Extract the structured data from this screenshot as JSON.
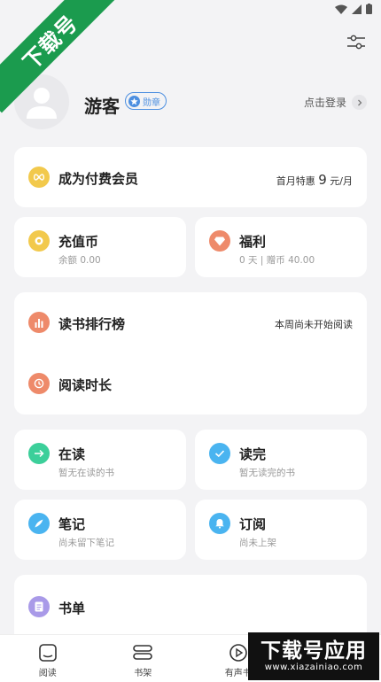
{
  "watermarks": {
    "top_left": "下载号",
    "bottom_right_big": "下载号应用",
    "bottom_right_small": "www.xiazainiao.com"
  },
  "profile": {
    "username": "游客",
    "badge_label": "勋章",
    "login_label": "点击登录"
  },
  "membership": {
    "title": "成为付费会员",
    "price_prefix": "首月特惠",
    "price_value": "9",
    "price_suffix": "元/月"
  },
  "recharge": {
    "title": "充值币",
    "sub": "余额 0.00"
  },
  "welfare": {
    "title": "福利",
    "sub": "0 天 | 赠币 40.00"
  },
  "ranking": {
    "title": "读书排行榜",
    "status": "本周尚未开始阅读"
  },
  "reading_time": {
    "title": "阅读时长"
  },
  "reading": {
    "title": "在读",
    "sub": "暂无在读的书"
  },
  "finished": {
    "title": "读完",
    "sub": "暂无读完的书"
  },
  "notes": {
    "title": "笔记",
    "sub": "尚未留下笔记"
  },
  "subscriptions": {
    "title": "订阅",
    "sub": "尚未上架"
  },
  "booklist": {
    "title": "书单"
  },
  "tabbar": {
    "items": [
      {
        "label": "阅读",
        "icon": "reader-icon"
      },
      {
        "label": "书架",
        "icon": "bookshelf-icon"
      },
      {
        "label": "有声书",
        "icon": "audio-icon"
      }
    ]
  },
  "colors": {
    "accent_blue": "#4d8fe0",
    "gold": "#f2c94c",
    "orange_red": "#ee8a6a",
    "green": "#3ccf9a",
    "sky": "#4ab4f0"
  }
}
